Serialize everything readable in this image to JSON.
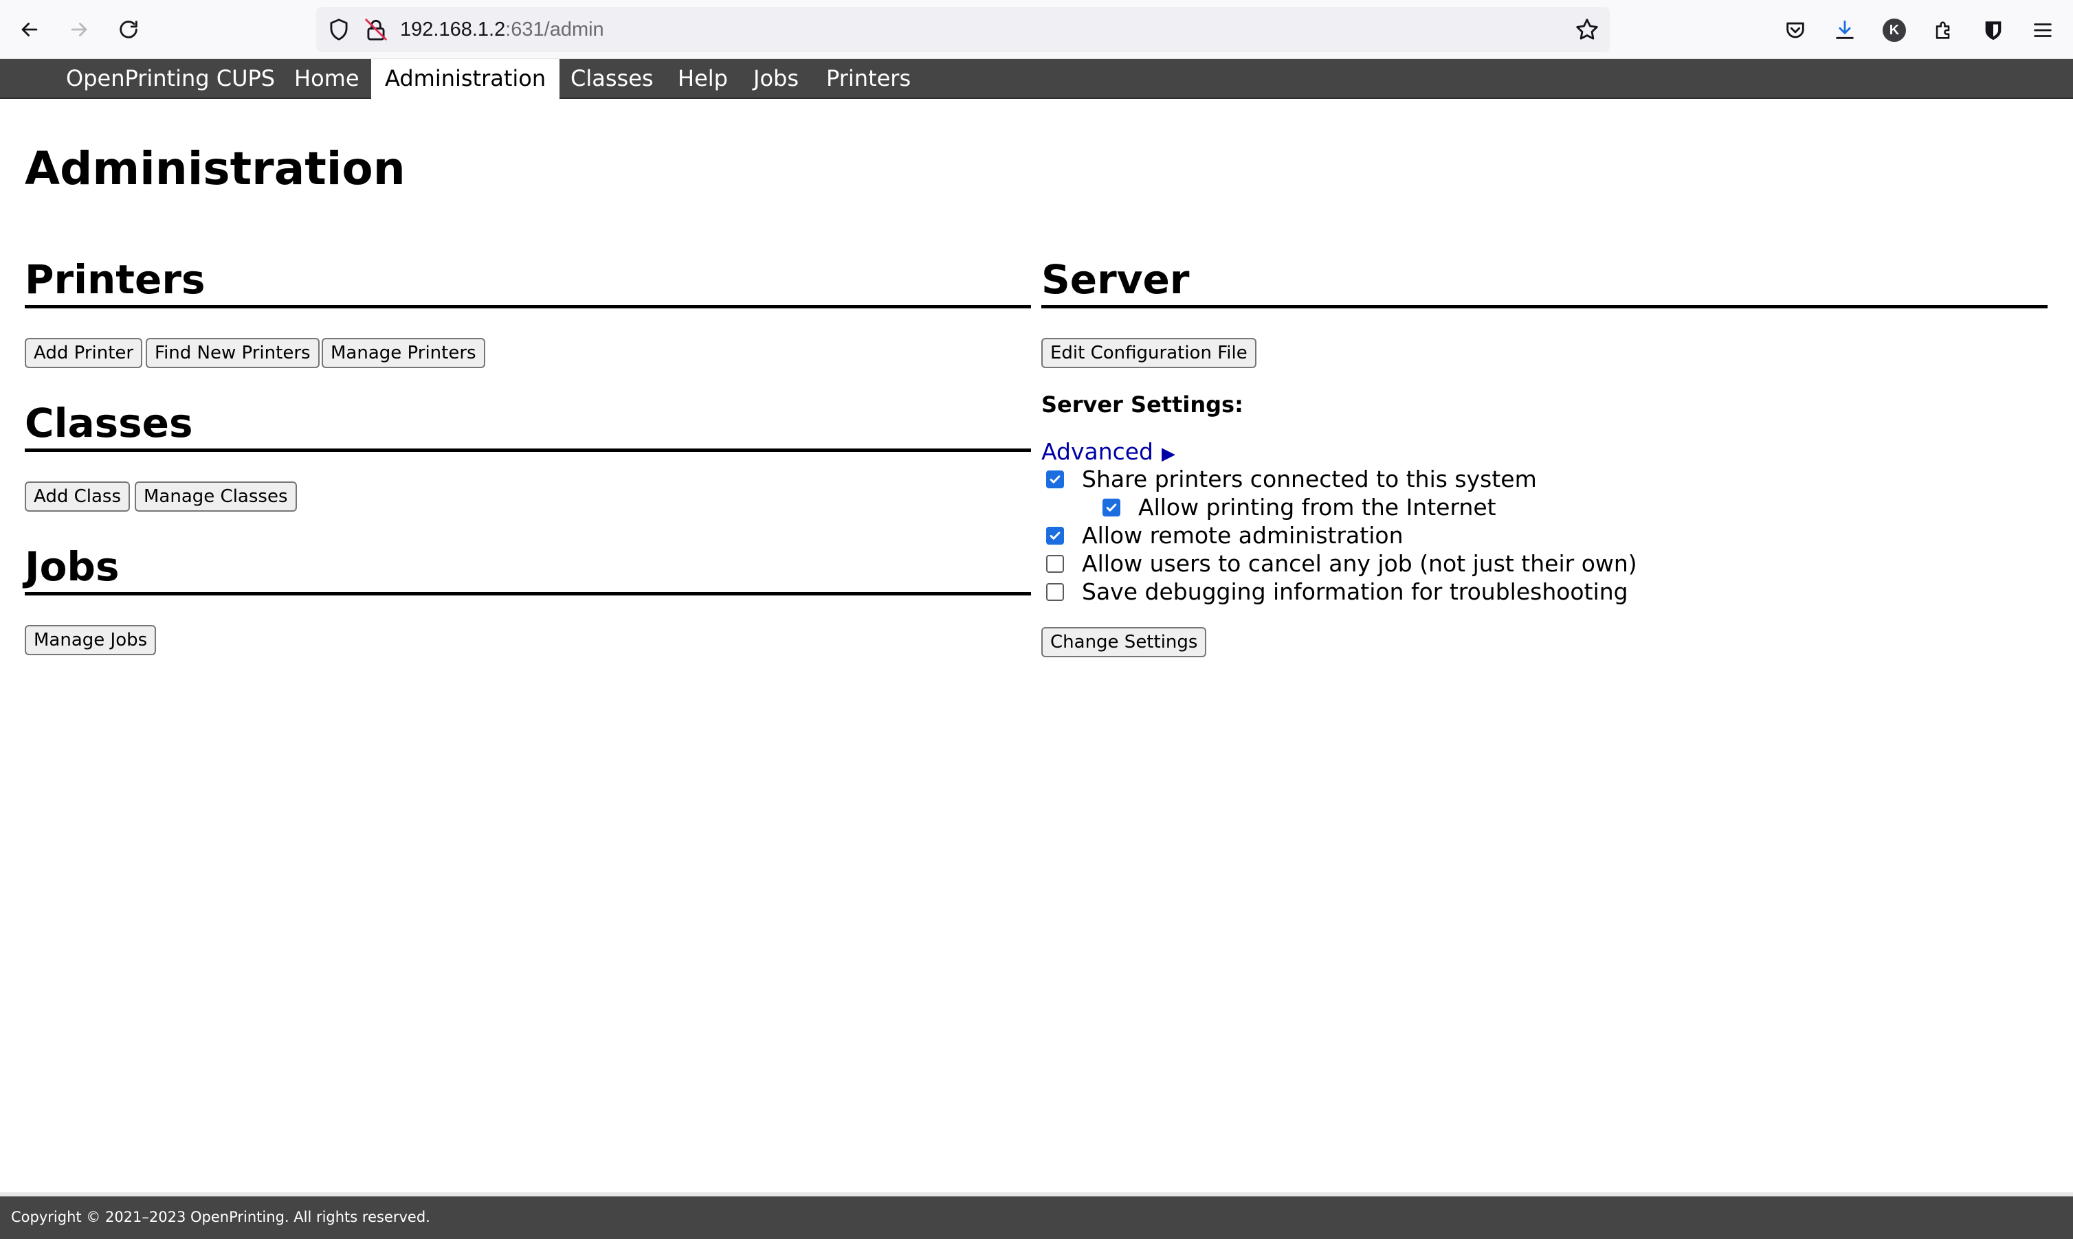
{
  "browser": {
    "url_host": "192.168.1.2",
    "url_path": ":631/admin",
    "toolbar_icons": [
      "pocket-icon",
      "download-icon",
      "account-icon",
      "extensions-icon",
      "bitwarden-icon",
      "menu-icon"
    ],
    "account_initial": "K"
  },
  "nav": {
    "brand": "OpenPrinting CUPS",
    "items": [
      "Home",
      "Administration",
      "Classes",
      "Help",
      "Jobs",
      "Printers"
    ],
    "active": "Administration"
  },
  "page": {
    "title": "Administration"
  },
  "printers": {
    "heading": "Printers",
    "buttons": [
      "Add Printer",
      "Find New Printers",
      "Manage Printers"
    ]
  },
  "classes": {
    "heading": "Classes",
    "buttons": [
      "Add Class",
      "Manage Classes"
    ]
  },
  "jobs": {
    "heading": "Jobs",
    "buttons": [
      "Manage Jobs"
    ]
  },
  "server": {
    "heading": "Server",
    "edit_config_button": "Edit Configuration File",
    "settings_label": "Server Settings:",
    "advanced_link": "Advanced",
    "options": [
      {
        "label": "Share printers connected to this system",
        "checked": true
      },
      {
        "label": "Allow printing from the Internet",
        "checked": true
      },
      {
        "label": "Allow remote administration",
        "checked": true
      },
      {
        "label": "Allow users to cancel any job (not just their own)",
        "checked": false
      },
      {
        "label": "Save debugging information for troubleshooting",
        "checked": false
      }
    ],
    "change_settings_button": "Change Settings"
  },
  "footer": {
    "copyright": "Copyright © 2021–2023 OpenPrinting. All rights reserved."
  },
  "colors": {
    "nav_bg": "#454545",
    "link": "#0000a8",
    "checkbox_checked": "#1c6de0"
  }
}
